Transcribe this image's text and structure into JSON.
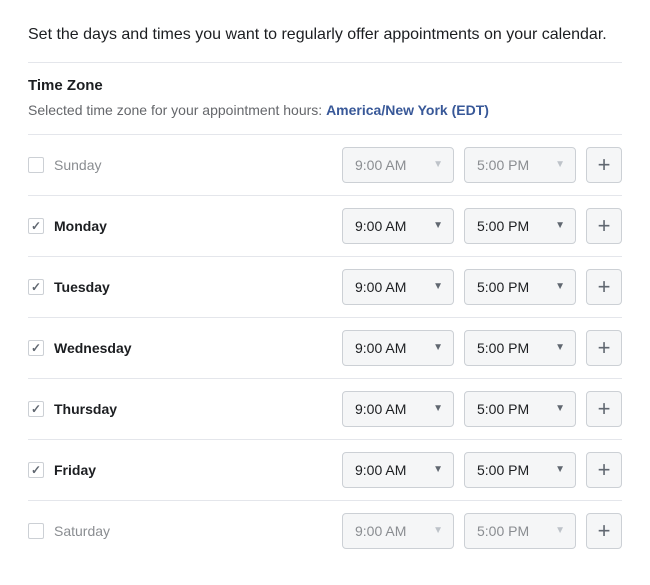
{
  "description": "Set the days and times you want to regularly offer appointments on your calendar.",
  "timezone": {
    "heading": "Time Zone",
    "label": "Selected time zone for your appointment hours: ",
    "value": "America/New York (EDT)"
  },
  "days": [
    {
      "name": "Sunday",
      "enabled": false,
      "start": "9:00 AM",
      "end": "5:00 PM"
    },
    {
      "name": "Monday",
      "enabled": true,
      "start": "9:00 AM",
      "end": "5:00 PM"
    },
    {
      "name": "Tuesday",
      "enabled": true,
      "start": "9:00 AM",
      "end": "5:00 PM"
    },
    {
      "name": "Wednesday",
      "enabled": true,
      "start": "9:00 AM",
      "end": "5:00 PM"
    },
    {
      "name": "Thursday",
      "enabled": true,
      "start": "9:00 AM",
      "end": "5:00 PM"
    },
    {
      "name": "Friday",
      "enabled": true,
      "start": "9:00 AM",
      "end": "5:00 PM"
    },
    {
      "name": "Saturday",
      "enabled": false,
      "start": "9:00 AM",
      "end": "5:00 PM"
    }
  ],
  "glyphs": {
    "caret": "▼",
    "plus": "+"
  }
}
